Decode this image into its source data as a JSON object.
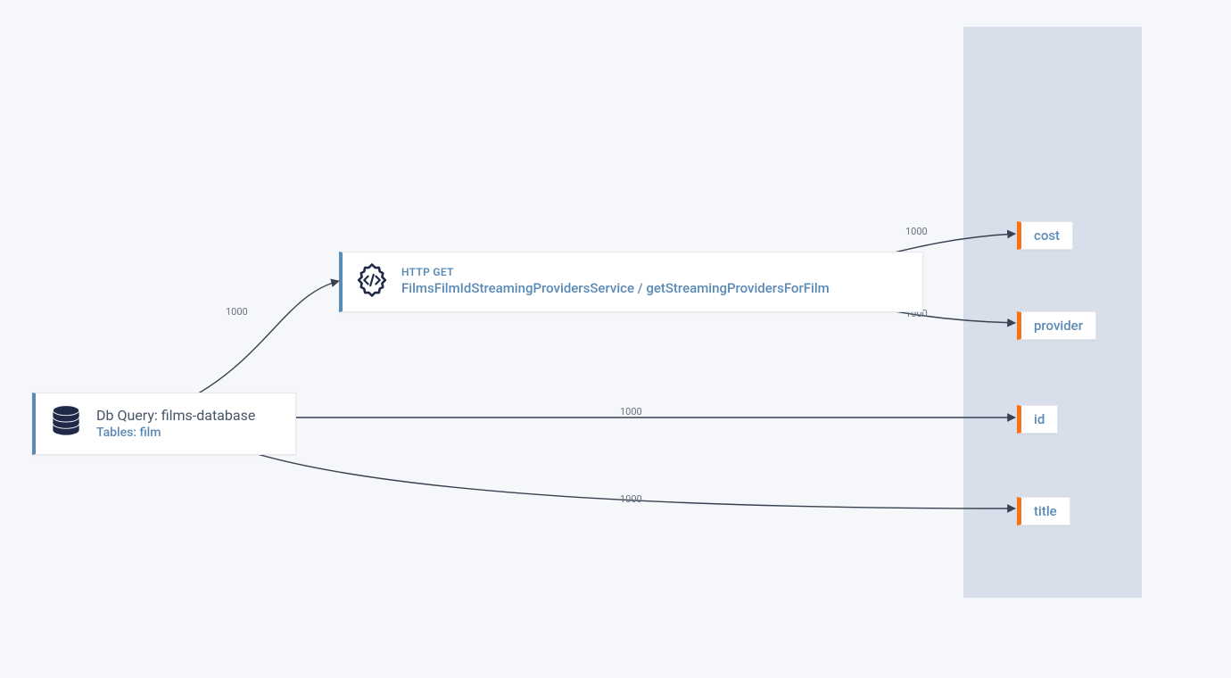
{
  "nodes": {
    "db": {
      "title": "Db Query: films-database",
      "subtitle": "Tables: film"
    },
    "http": {
      "method": "HTTP GET",
      "service": "FilmsFilmIdStreamingProvidersService / getStreamingProvidersForFilm"
    }
  },
  "outputs": {
    "cost": "cost",
    "provider": "provider",
    "id": "id",
    "title": "title"
  },
  "edges": {
    "db_to_http": "1000",
    "http_to_cost": "1000",
    "http_to_provider": "1000",
    "db_to_id": "1000",
    "db_to_title": "1000"
  }
}
